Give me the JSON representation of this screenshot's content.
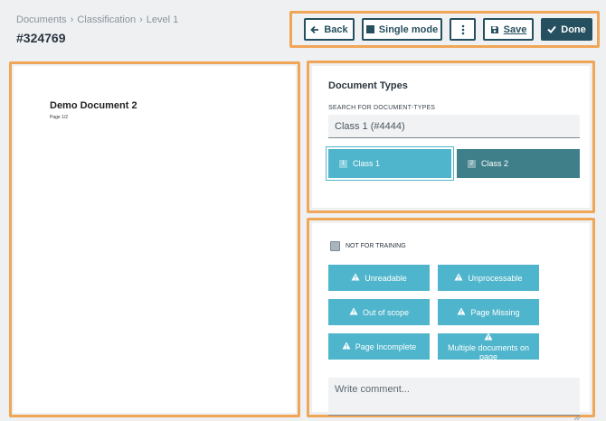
{
  "breadcrumb": {
    "items": [
      "Documents",
      "Classification",
      "Level 1"
    ],
    "separator": "›"
  },
  "document_id": "#324769",
  "toolbar": {
    "back": "Back",
    "single_mode": "Single mode",
    "save": "Save",
    "done": "Done"
  },
  "preview": {
    "title": "Demo Document 2",
    "page": "Page 1/2"
  },
  "document_types": {
    "title": "Document Types",
    "search_label": "SEARCH FOR DOCUMENT-TYPES",
    "search_value": "Class 1 (#4444)",
    "classes": [
      {
        "shortcut": "1",
        "label": "Class 1",
        "selected": true
      },
      {
        "shortcut": "2",
        "label": "Class 2",
        "selected": false
      }
    ]
  },
  "issues": {
    "not_for_training": "NOT FOR TRAINING",
    "buttons": [
      "Unreadable",
      "Unprocessable",
      "Out of scope",
      "Page Missing",
      "Page Incomplete",
      "Multiple documents on page"
    ],
    "comment_placeholder": "Write comment..."
  },
  "colors": {
    "highlight": "#f0a657",
    "primary_dark": "#264f5f",
    "accent": "#4fb5cc",
    "class_unselected": "#3f7f89"
  },
  "icons": {
    "back": "arrow-left-icon",
    "single_mode": "square-icon",
    "more": "vertical-ellipsis-icon",
    "save": "floppy-disk-icon",
    "done": "checkmark-icon",
    "issue": "warning-triangle-icon"
  }
}
